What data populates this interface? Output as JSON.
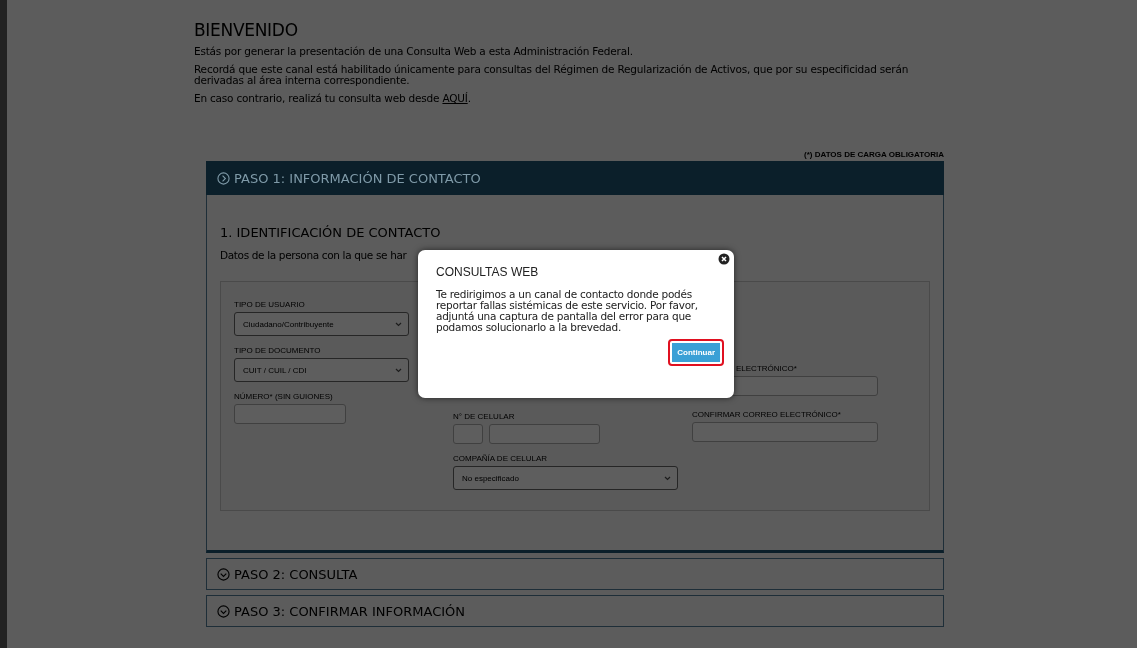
{
  "page": {
    "title": "BIENVENIDO",
    "paragraphs": [
      "Estás por generar la presentación de una Consulta Web a esta Administración Federal.",
      "Recordá que este canal está habilitado únicamente para consultas del Régimen de Regularización de Activos, que por su especificidad serán derivadas al área interna correspondiente."
    ],
    "link_sentence": {
      "text": "En caso contrario, realizá tu consulta web desde ",
      "link": "AQUÍ",
      "after": "."
    },
    "required_note": "(*) DATOS DE CARGA OBLIGATORIA"
  },
  "steps": [
    {
      "label": "PASO 1: INFORMACIÓN DE CONTACTO",
      "expanded": true
    },
    {
      "label": "PASO 2: CONSULTA",
      "expanded": false
    },
    {
      "label": "PASO 3: CONFIRMAR INFORMACIÓN",
      "expanded": false
    }
  ],
  "section": {
    "title": "1. IDENTIFICACIÓN DE CONTACTO",
    "subtitle": "Datos de la persona con la que se har"
  },
  "form": {
    "column_1": [
      {
        "kind": "select",
        "label": "TIPO DE USUARIO",
        "value": "Ciudadano/Contribuyente"
      },
      {
        "kind": "select",
        "label": "TIPO DE DOCUMENTO",
        "value": "CUIT / CUIL / CDI"
      },
      {
        "kind": "input",
        "label": "NÚMERO* (SIN GUIONES)"
      }
    ],
    "column_2": [
      {
        "kind": "phone",
        "label": "N° DE CELULAR"
      },
      {
        "kind": "select",
        "label": "COMPAÑÍA DE CELULAR",
        "value": "No especificado"
      }
    ],
    "column_3": [
      {
        "kind": "input",
        "label": "ELECTRÓNICO*"
      },
      {
        "kind": "input",
        "label": "CONFIRMAR CORREO ELECTRÓNICO*"
      }
    ]
  },
  "dialog": {
    "title": "CONSULTAS WEB",
    "message": "Te redirigimos a un canal de contacto donde podés reportar fallas sistémicas de este servicio. Por favor, adjuntá una captura de pantalla del error para que podamos solucionarlo a la brevedad.",
    "button": "Continuar"
  }
}
